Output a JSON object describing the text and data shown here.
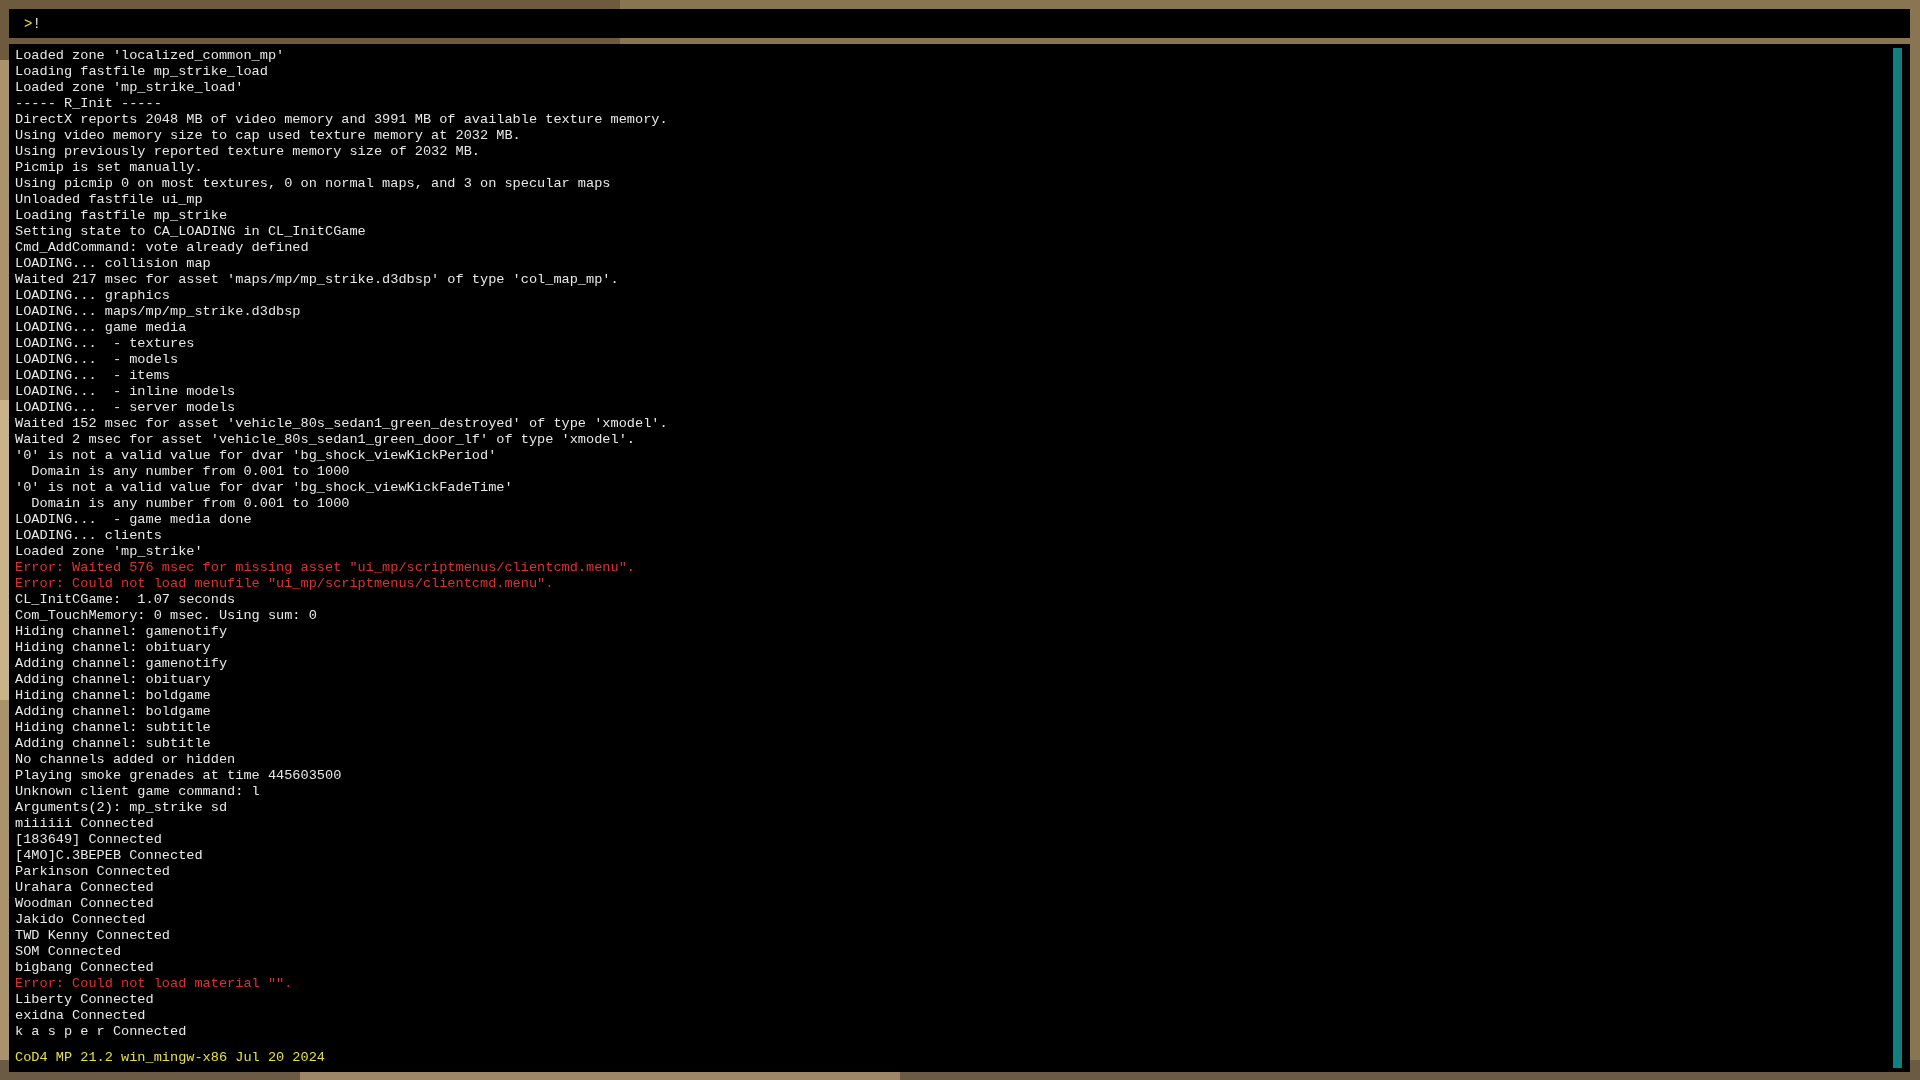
{
  "console": {
    "prompt": ">",
    "input": "!",
    "lines": [
      {
        "kind": "info",
        "text": "Loaded zone 'localized_common_mp'"
      },
      {
        "kind": "info",
        "text": "Loading fastfile mp_strike_load"
      },
      {
        "kind": "info",
        "text": "Loaded zone 'mp_strike_load'"
      },
      {
        "kind": "info",
        "text": "----- R_Init -----"
      },
      {
        "kind": "info",
        "text": "DirectX reports 2048 MB of video memory and 3991 MB of available texture memory."
      },
      {
        "kind": "info",
        "text": "Using video memory size to cap used texture memory at 2032 MB."
      },
      {
        "kind": "info",
        "text": "Using previously reported texture memory size of 2032 MB."
      },
      {
        "kind": "info",
        "text": "Picmip is set manually."
      },
      {
        "kind": "info",
        "text": "Using picmip 0 on most textures, 0 on normal maps, and 3 on specular maps"
      },
      {
        "kind": "info",
        "text": "Unloaded fastfile ui_mp"
      },
      {
        "kind": "info",
        "text": "Loading fastfile mp_strike"
      },
      {
        "kind": "info",
        "text": "Setting state to CA_LOADING in CL_InitCGame"
      },
      {
        "kind": "info",
        "text": "Cmd_AddCommand: vote already defined"
      },
      {
        "kind": "info",
        "text": "LOADING... collision map"
      },
      {
        "kind": "info",
        "text": "Waited 217 msec for asset 'maps/mp/mp_strike.d3dbsp' of type 'col_map_mp'."
      },
      {
        "kind": "info",
        "text": "LOADING... graphics"
      },
      {
        "kind": "info",
        "text": "LOADING... maps/mp/mp_strike.d3dbsp"
      },
      {
        "kind": "info",
        "text": "LOADING... game media"
      },
      {
        "kind": "info",
        "text": "LOADING...  - textures"
      },
      {
        "kind": "info",
        "text": "LOADING...  - models"
      },
      {
        "kind": "info",
        "text": "LOADING...  - items"
      },
      {
        "kind": "info",
        "text": "LOADING...  - inline models"
      },
      {
        "kind": "info",
        "text": "LOADING...  - server models"
      },
      {
        "kind": "info",
        "text": "Waited 152 msec for asset 'vehicle_80s_sedan1_green_destroyed' of type 'xmodel'."
      },
      {
        "kind": "info",
        "text": "Waited 2 msec for asset 'vehicle_80s_sedan1_green_door_lf' of type 'xmodel'."
      },
      {
        "kind": "info",
        "text": "'0' is not a valid value for dvar 'bg_shock_viewKickPeriod'"
      },
      {
        "kind": "info",
        "text": "  Domain is any number from 0.001 to 1000"
      },
      {
        "kind": "info",
        "text": "'0' is not a valid value for dvar 'bg_shock_viewKickFadeTime'"
      },
      {
        "kind": "info",
        "text": "  Domain is any number from 0.001 to 1000"
      },
      {
        "kind": "info",
        "text": "LOADING...  - game media done"
      },
      {
        "kind": "info",
        "text": "LOADING... clients"
      },
      {
        "kind": "info",
        "text": "Loaded zone 'mp_strike'"
      },
      {
        "kind": "error",
        "text": "Error: Waited 576 msec for missing asset \"ui_mp/scriptmenus/clientcmd.menu\"."
      },
      {
        "kind": "error",
        "text": "Error: Could not load menufile \"ui_mp/scriptmenus/clientcmd.menu\"."
      },
      {
        "kind": "info",
        "text": "CL_InitCGame:  1.07 seconds"
      },
      {
        "kind": "info",
        "text": "Com_TouchMemory: 0 msec. Using sum: 0"
      },
      {
        "kind": "info",
        "text": "Hiding channel: gamenotify"
      },
      {
        "kind": "info",
        "text": "Hiding channel: obituary"
      },
      {
        "kind": "info",
        "text": "Adding channel: gamenotify"
      },
      {
        "kind": "info",
        "text": "Adding channel: obituary"
      },
      {
        "kind": "info",
        "text": "Hiding channel: boldgame"
      },
      {
        "kind": "info",
        "text": "Adding channel: boldgame"
      },
      {
        "kind": "info",
        "text": "Hiding channel: subtitle"
      },
      {
        "kind": "info",
        "text": "Adding channel: subtitle"
      },
      {
        "kind": "info",
        "text": "No channels added or hidden"
      },
      {
        "kind": "info",
        "text": "Playing smoke grenades at time 445603500"
      },
      {
        "kind": "info",
        "text": "Unknown client game command: l"
      },
      {
        "kind": "info",
        "text": "Arguments(2): mp_strike sd"
      },
      {
        "kind": "info",
        "text": "miiiiii Connected"
      },
      {
        "kind": "info",
        "text": "[183649] Connected"
      },
      {
        "kind": "info",
        "text": "[4MO]C.3BEPEB Connected"
      },
      {
        "kind": "info",
        "text": "Parkinson Connected"
      },
      {
        "kind": "info",
        "text": "Urahara Connected"
      },
      {
        "kind": "info",
        "text": "Woodman Connected"
      },
      {
        "kind": "info",
        "text": "Jakido Connected"
      },
      {
        "kind": "info",
        "text": "TWD Kenny Connected"
      },
      {
        "kind": "info",
        "text": "SOM Connected"
      },
      {
        "kind": "info",
        "text": "bigbang Connected"
      },
      {
        "kind": "error",
        "text": "Error: Could not load material \"\"."
      },
      {
        "kind": "info",
        "text": "Liberty Connected"
      },
      {
        "kind": "info",
        "text": "exidna Connected"
      },
      {
        "kind": "info",
        "text": "k a s p e r Connected"
      }
    ],
    "version": "CoD4 MP 21.2 win_mingw-x86 Jul 20 2024"
  }
}
